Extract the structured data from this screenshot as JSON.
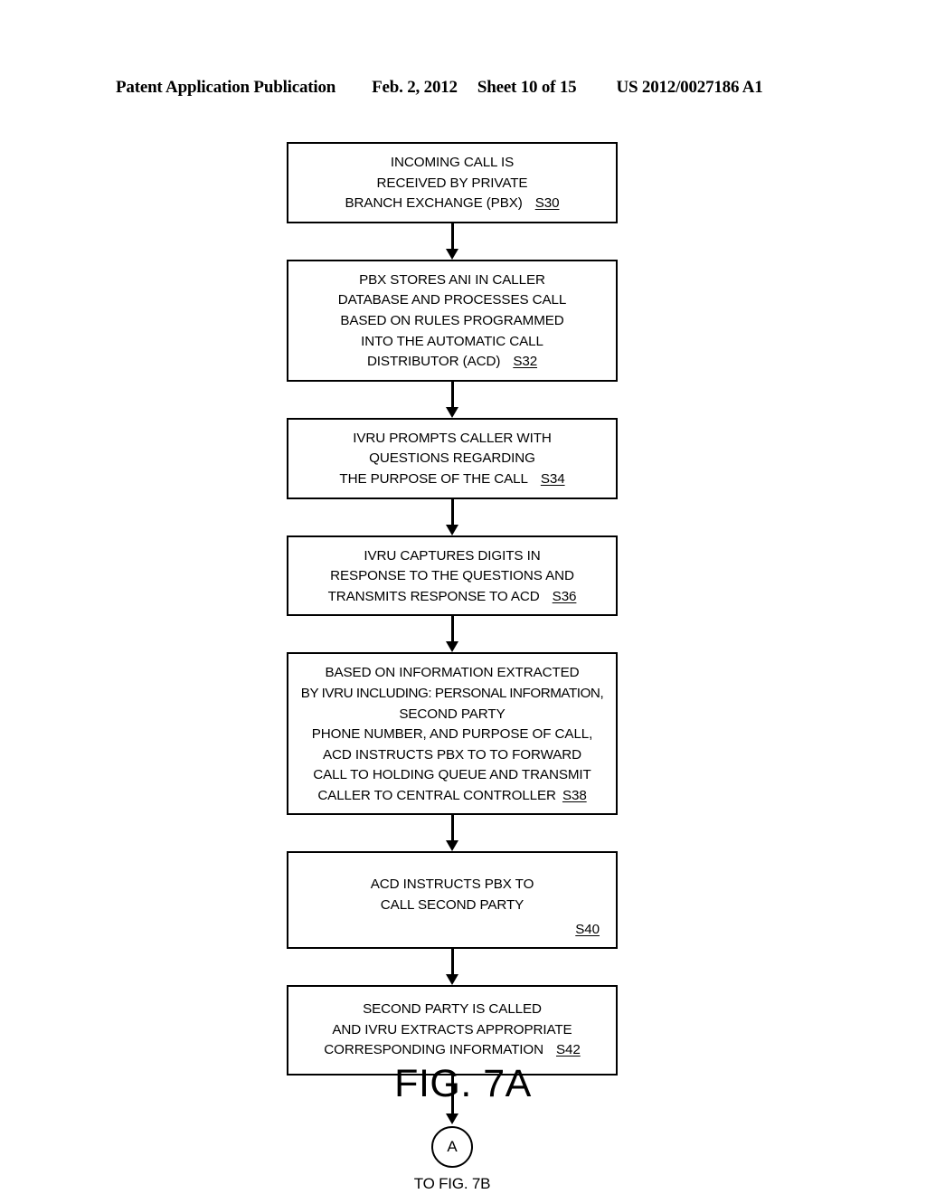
{
  "header": {
    "title": "Patent Application Publication",
    "date": "Feb. 2, 2012",
    "sheet": "Sheet 10 of 15",
    "publication_number": "US 2012/0027186 A1"
  },
  "figure": {
    "caption": "FIG. 7A"
  },
  "flowchart": {
    "steps": [
      {
        "id": "S30",
        "label": "S30",
        "label_position": "inline",
        "lines": [
          "INCOMING CALL IS",
          "RECEIVED BY PRIVATE",
          "BRANCH EXCHANGE (PBX)"
        ]
      },
      {
        "id": "S32",
        "label": "S32",
        "label_position": "inline",
        "lines": [
          "PBX STORES ANI IN CALLER",
          "DATABASE AND PROCESSES CALL",
          "BASED ON RULES PROGRAMMED",
          "INTO THE AUTOMATIC CALL",
          "DISTRIBUTOR (ACD)"
        ]
      },
      {
        "id": "S34",
        "label": "S34",
        "label_position": "inline",
        "lines": [
          "IVRU PROMPTS CALLER WITH",
          "QUESTIONS REGARDING",
          "THE PURPOSE OF THE CALL"
        ]
      },
      {
        "id": "S36",
        "label": "S36",
        "label_position": "inline",
        "lines": [
          "IVRU CAPTURES DIGITS IN",
          "RESPONSE TO THE QUESTIONS AND",
          "TRANSMITS RESPONSE TO ACD"
        ]
      },
      {
        "id": "S38",
        "label": "S38",
        "label_position": "inline",
        "lines": [
          "BASED ON INFORMATION EXTRACTED",
          "BY IVRU INCLUDING: PERSONAL INFORMATION,",
          "SECOND PARTY",
          "PHONE NUMBER, AND PURPOSE OF CALL,",
          "ACD INSTRUCTS PBX TO TO FORWARD",
          "CALL TO HOLDING QUEUE AND TRANSMIT",
          "CALLER TO CENTRAL CONTROLLER"
        ]
      },
      {
        "id": "S40",
        "label": "S40",
        "label_position": "own-line",
        "lines": [
          "ACD INSTRUCTS PBX TO",
          "CALL SECOND PARTY"
        ]
      },
      {
        "id": "S42",
        "label": "S42",
        "label_position": "inline",
        "lines": [
          "SECOND PARTY IS CALLED",
          "AND IVRU EXTRACTS APPROPRIATE",
          "CORRESPONDING INFORMATION"
        ]
      }
    ],
    "connector": {
      "symbol": "A",
      "caption": "TO FIG. 7B"
    }
  }
}
